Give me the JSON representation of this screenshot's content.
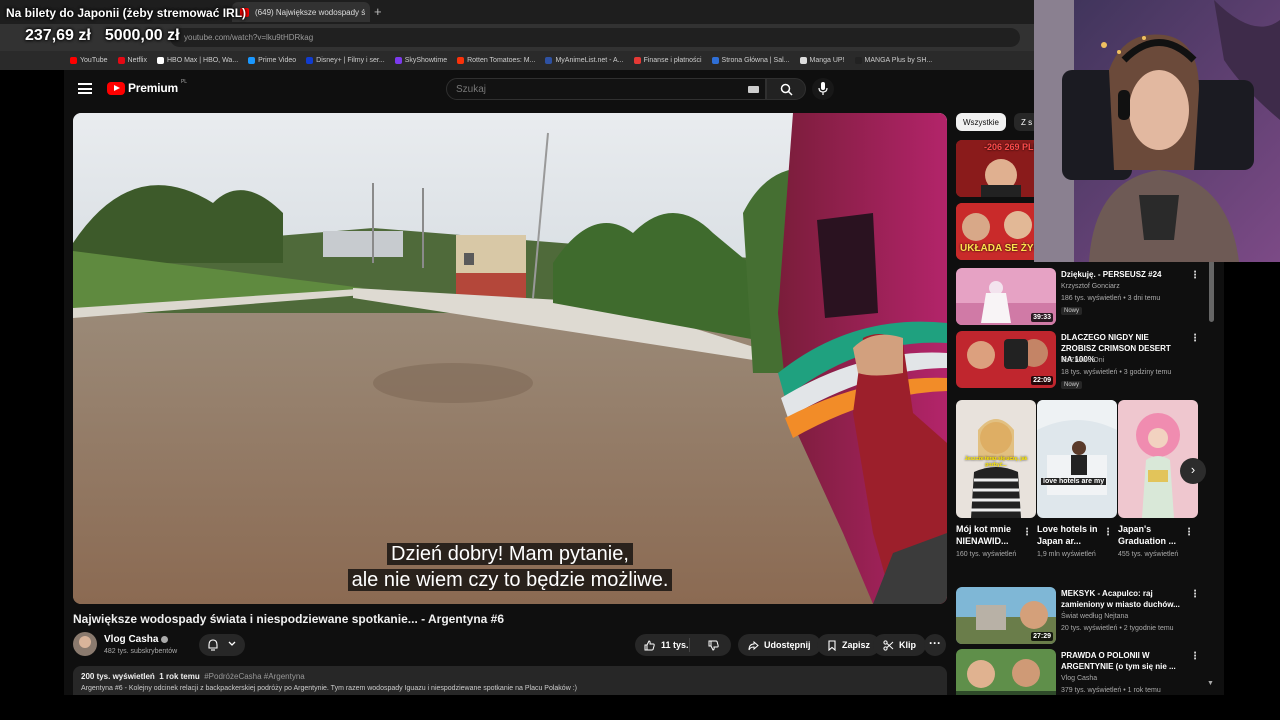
{
  "browser": {
    "tabs": [
      {
        "label": "(649) Największe wodospady ś"
      }
    ],
    "url": "youtube.com/watch?v=lku9tHDRkag",
    "bookmarks": [
      {
        "label": "YouTube",
        "color": "#ff0000"
      },
      {
        "label": "Netflix",
        "color": "#e50914"
      },
      {
        "label": "HBO Max | HBO, Wa...",
        "color": "#ffffff"
      },
      {
        "label": "Prime Video",
        "color": "#1a98ff"
      },
      {
        "label": "Disney+ | Filmy i ser...",
        "color": "#113ccf"
      },
      {
        "label": "SkyShowtime",
        "color": "#7c3aed"
      },
      {
        "label": "Rotten Tomatoes: M...",
        "color": "#fa320a"
      },
      {
        "label": "MyAnimeList.net - A...",
        "color": "#2e51a2"
      },
      {
        "label": "Finanse i płatności",
        "color": "#e53935"
      },
      {
        "label": "Strona Główna | Sal...",
        "color": "#2f6fd6"
      },
      {
        "label": "Manga UP!",
        "color": "#dddddd"
      },
      {
        "label": "MANGA Plus by SH...",
        "color": "#222222"
      }
    ]
  },
  "overlay": {
    "goal_title": "Na bilety do Japonii (żeby stremować IRL)",
    "current_amount": "237,69 zł",
    "goal_amount": "5000,00 zł"
  },
  "youtube": {
    "logo_text": "Premium",
    "logo_sup": "PL",
    "search_placeholder": "Szukaj",
    "subtitles": [
      "Dzień dobry! Mam pytanie,",
      "ale nie wiem czy to będzie możliwe."
    ],
    "video_title": "Największe wodospady świata i niespodziewane spotkanie... - Argentyna #6",
    "channel": {
      "name": "Vlog Casha",
      "subscribers": "482 tys. subskrybentów"
    },
    "actions": {
      "likes": "11 tys.",
      "share": "Udostępnij",
      "save": "Zapisz",
      "clip": "Klip"
    },
    "description": {
      "views": "200 tys. wyświetleń",
      "date": "1 rok temu",
      "tags": "#PodróżeCasha #Argentyna",
      "text": "Argentyna #6 - Kolejny odcinek relacji z backpackerskiej podróży po Argentynie. Tym razem wodospady Iguazu i niespodziewane spotkanie na Placu Polaków :)"
    },
    "chips": [
      "Wszystkie",
      "Z s"
    ],
    "recommendations": [
      {
        "title": "Dziękuję. - PERSEUSZ #24",
        "channel": "Krzysztof Gonciarz",
        "views": "186 tys. wyświetleń • 3 dni temu",
        "badge": "Nowy",
        "duration": "39:33"
      },
      {
        "title": "DLACZEGO NIGDY NIE ZROBISZ CRIMSON DESERT NA 100%",
        "channel": "To Znowu Oni",
        "views": "18 tys. wyświetleń • 3 godziny temu",
        "badge": "Nowy",
        "duration": "22:09"
      },
      {
        "title": "MEKSYK - Acapulco: raj zamieniony w miasto duchów...",
        "channel": "Świat według Nejtana",
        "views": "20 tys. wyświetleń • 2 tygodnie temu",
        "duration": "27:29"
      },
      {
        "title": "PRAWDA O POLONII W ARGENTYNIE (o tym się nie ...",
        "channel": "Vlog Casha",
        "views": "379 tys. wyświetleń • 1 rok temu"
      }
    ],
    "top_thumbs": [
      {
        "text": "-206 269 PLN"
      },
      {
        "text": "UKŁADA SE ŻYC"
      }
    ],
    "shorts": [
      {
        "title": "Mój kot mnie NIENAWID...",
        "views": "160 tys. wyświetleń",
        "caption": "Jeszcze teraz się uczę, jak pozbyć..."
      },
      {
        "title": "Love hotels in Japan ar...",
        "views": "1,9 mln wyświetleń",
        "caption": "love hotels are my"
      },
      {
        "title": "Japan's Graduation ...",
        "views": "455 tys. wyświetleń",
        "caption": ""
      }
    ]
  }
}
